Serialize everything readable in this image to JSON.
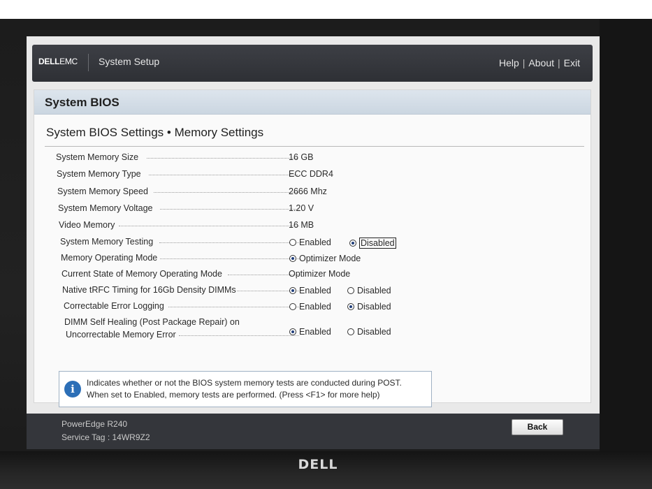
{
  "header": {
    "brand_main": "DELL",
    "brand_sub": "EMC",
    "app_title": "System Setup",
    "links": [
      "Help",
      "About",
      "Exit"
    ]
  },
  "page": {
    "title": "System BIOS",
    "subtitle": "System BIOS Settings • Memory Settings"
  },
  "settings": {
    "mem_size": {
      "label": "System Memory Size",
      "value": "16 GB"
    },
    "mem_type": {
      "label": "System Memory Type",
      "value": "ECC DDR4"
    },
    "mem_speed": {
      "label": "System Memory Speed",
      "value": "2666 Mhz"
    },
    "mem_voltage": {
      "label": "System Memory Voltage",
      "value": "1.20 V"
    },
    "video_mem": {
      "label": "Video Memory",
      "value": "16 MB"
    },
    "mem_testing": {
      "label": "System Memory Testing",
      "option1": "Enabled",
      "option2": "Disabled",
      "selected": "Disabled"
    },
    "op_mode": {
      "label": "Memory Operating Mode",
      "option1": "Optimizer Mode",
      "selected": "Optimizer Mode"
    },
    "cur_mode": {
      "label": "Current State of Memory Operating Mode",
      "value": "Optimizer Mode"
    },
    "trfc": {
      "label": "Native tRFC Timing for 16Gb Density DIMMs",
      "option1": "Enabled",
      "option2": "Disabled",
      "selected": "Enabled"
    },
    "err_log": {
      "label": "Correctable Error Logging",
      "option1": "Enabled",
      "option2": "Disabled",
      "selected": "Disabled"
    },
    "dimm_heal": {
      "label_line1": "DIMM Self Healing (Post Package Repair) on",
      "label_line2": "Uncorrectable Memory Error",
      "option1": "Enabled",
      "option2": "Disabled",
      "selected": "Enabled"
    }
  },
  "info": {
    "line1": "Indicates whether or not the BIOS system memory tests are conducted during POST.",
    "line2": "When set to Enabled, memory tests are performed. (Press <F1> for more help)"
  },
  "footer": {
    "model": "PowerEdge R240",
    "service_tag": "Service Tag : 14WR9Z2",
    "back_label": "Back"
  },
  "monitor": {
    "logo": "DELL"
  }
}
